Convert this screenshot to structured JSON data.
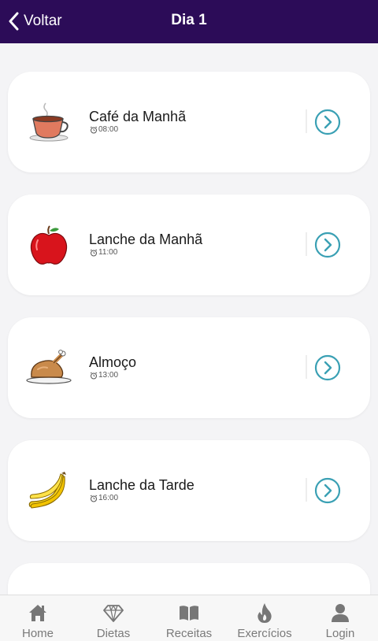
{
  "header": {
    "back_label": "Voltar",
    "title": "Dia 1"
  },
  "meals": [
    {
      "name": "Café da Manhã",
      "time": "08:00",
      "icon": "coffee-cup-icon"
    },
    {
      "name": "Lanche da Manhã",
      "time": "11:00",
      "icon": "apple-icon"
    },
    {
      "name": "Almoço",
      "time": "13:00",
      "icon": "roast-chicken-icon"
    },
    {
      "name": "Lanche da Tarde",
      "time": "16:00",
      "icon": "bananas-icon"
    }
  ],
  "tabs": [
    {
      "label": "Home",
      "icon": "home-icon"
    },
    {
      "label": "Dietas",
      "icon": "diamond-icon"
    },
    {
      "label": "Receitas",
      "icon": "book-icon"
    },
    {
      "label": "Exercícios",
      "icon": "flame-icon"
    },
    {
      "label": "Login",
      "icon": "user-icon"
    }
  ],
  "colors": {
    "header_bg": "#2c0c58",
    "accent": "#3aa0b4",
    "tab_icon": "#777777"
  }
}
